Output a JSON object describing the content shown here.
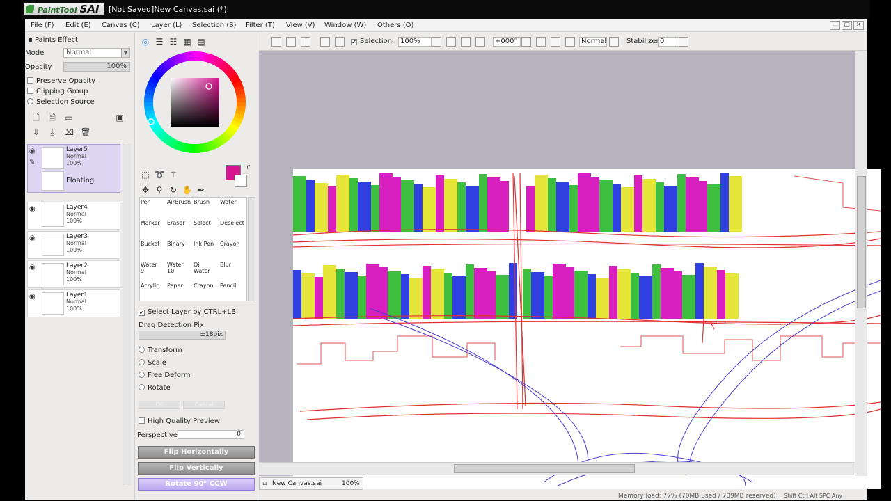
{
  "titlebar": {
    "logo_text": "PaintTool",
    "logo_sai": "SAI",
    "title": "[Not Saved]New Canvas.sai (*)"
  },
  "menu": [
    "File (F)",
    "Edit (E)",
    "Canvas (C)",
    "Layer (L)",
    "Selection (S)",
    "Filter (T)",
    "View (V)",
    "Window (W)",
    "Others (O)"
  ],
  "window_buttons": [
    "▭",
    "▢",
    "✕"
  ],
  "left_panel": {
    "paints_effect": "Paints Effect",
    "mode_label": "Mode",
    "mode_value": "Normal",
    "opacity_label": "Opacity",
    "opacity_value": "100%",
    "preserve_opacity": "Preserve Opacity",
    "clipping_group": "Clipping Group",
    "selection_source": "Selection Source",
    "floating_label": "Floating",
    "layers": [
      {
        "name": "Layer5",
        "mode": "Normal",
        "opacity": "100%"
      },
      {
        "name": "Layer4",
        "mode": "Normal",
        "opacity": "100%"
      },
      {
        "name": "Layer3",
        "mode": "Normal",
        "opacity": "100%"
      },
      {
        "name": "Layer2",
        "mode": "Normal",
        "opacity": "100%"
      },
      {
        "name": "Layer1",
        "mode": "Normal",
        "opacity": "100%"
      }
    ]
  },
  "tools_panel": {
    "primary_color": "#d6148f",
    "tools": [
      {
        "name": "Pen",
        "size": ""
      },
      {
        "name": "AirBrush",
        "size": ""
      },
      {
        "name": "Brush",
        "size": ""
      },
      {
        "name": "Water",
        "size": ""
      },
      {
        "name": "Marker",
        "size": ""
      },
      {
        "name": "Eraser",
        "size": ""
      },
      {
        "name": "Select",
        "size": ""
      },
      {
        "name": "Deselect",
        "size": ""
      },
      {
        "name": "Bucket",
        "size": ""
      },
      {
        "name": "Binary",
        "size": ""
      },
      {
        "name": "Ink Pen",
        "size": ""
      },
      {
        "name": "Crayon",
        "size": ""
      },
      {
        "name": "Water",
        "size": "9"
      },
      {
        "name": "Water",
        "size": "10"
      },
      {
        "name": "Oil Water",
        "size": ""
      },
      {
        "name": "Blur",
        "size": ""
      },
      {
        "name": "Acrylic",
        "size": ""
      },
      {
        "name": "Paper",
        "size": ""
      },
      {
        "name": "Crayon",
        "size": ""
      },
      {
        "name": "Pencil",
        "size": ""
      }
    ],
    "select_layer_ctrl": "Select Layer by CTRL+LB",
    "drag_detection": "Drag Detection Pix.",
    "drag_value": "±18pix",
    "transform": "Transform",
    "scale": "Scale",
    "free_deform": "Free Deform",
    "rotate": "Rotate",
    "ok": "OK",
    "cancel": "Cancel",
    "high_quality_preview": "High Quality Preview",
    "perspective_label": "Perspective",
    "perspective_value": "0",
    "flip_horizontally": "Flip Horizontally",
    "flip_vertically": "Flip Vertically",
    "rotate_90_ccw": "Rotate 90° CCW"
  },
  "toolbar": {
    "selection_label": "Selection",
    "zoom": "100%",
    "angle": "+000°",
    "blend": "Normal",
    "stabilizer_label": "Stabilizer",
    "stabilizer_value": "0"
  },
  "document_tab": {
    "name": "New Canvas.sai",
    "zoom": "100%"
  },
  "status": {
    "memory": "Memory load: 77% (70MB used / 709MB reserved)",
    "keys": "Shift Ctrl Alt SPC Any"
  }
}
